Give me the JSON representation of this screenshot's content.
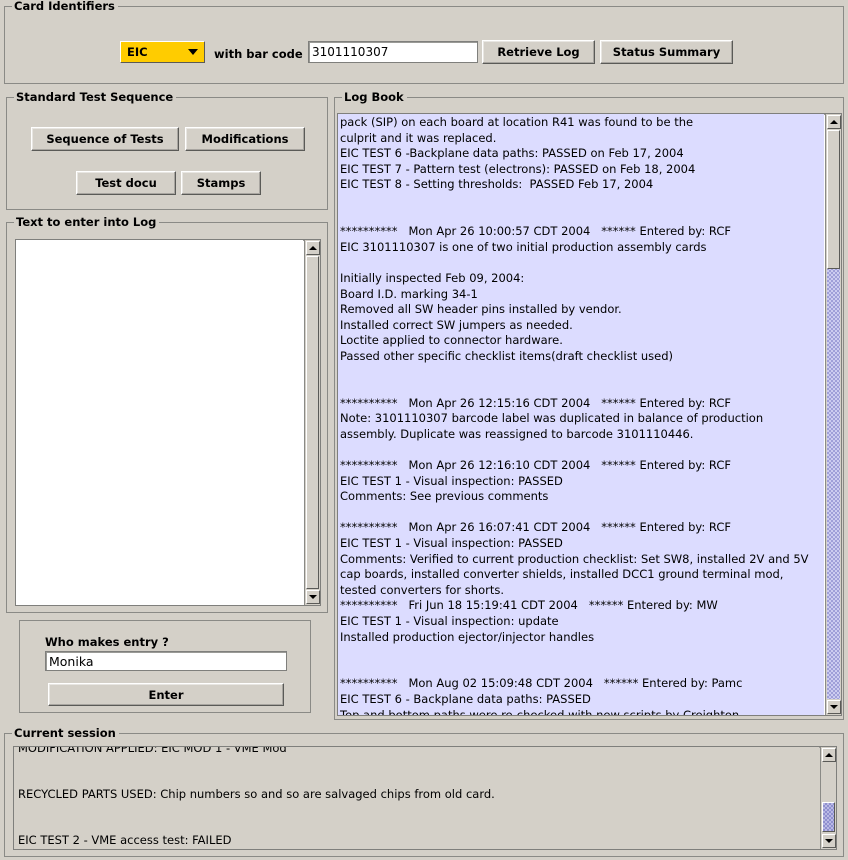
{
  "card_identifiers": {
    "title": "Card Identifiers",
    "card_type_selected": "EIC",
    "card_type_options": [
      "EIC"
    ],
    "with_barcode_label": "with bar code",
    "barcode_value": "3101110307",
    "retrieve_log_label": "Retrieve Log",
    "status_summary_label": "Status Summary",
    "combo_color": "#ffcc00"
  },
  "standard_test_sequence": {
    "title": "Standard Test Sequence",
    "buttons": [
      {
        "label": "Sequence of Tests"
      },
      {
        "label": "Modifications"
      },
      {
        "label": "Test docu"
      },
      {
        "label": "Stamps"
      }
    ]
  },
  "text_to_enter": {
    "title": "Text to enter into Log",
    "value": "",
    "placeholder": ""
  },
  "entry_panel": {
    "who_label": "Who makes entry ?",
    "who_value": "Monika",
    "enter_label": "Enter"
  },
  "log_book": {
    "title": "Log Book",
    "background_color": "#dcdcff",
    "text": "pack (SIP) on each board at location R41 was found to be the\nculprit and it was replaced.\nEIC TEST 6 -Backplane data paths: PASSED on Feb 17, 2004\nEIC TEST 7 - Pattern test (electrons): PASSED on Feb 18, 2004\nEIC TEST 8 - Setting thresholds:  PASSED Feb 17, 2004\n\n\n**********   Mon Apr 26 10:00:57 CDT 2004   ****** Entered by: RCF\nEIC 3101110307 is one of two initial production assembly cards\n\nInitially inspected Feb 09, 2004:\nBoard I.D. marking 34-1\nRemoved all SW header pins installed by vendor.\nInstalled correct SW jumpers as needed.\nLoctite applied to connector hardware.\nPassed other specific checklist items(draft checklist used)\n\n\n**********   Mon Apr 26 12:15:16 CDT 2004   ****** Entered by: RCF\nNote: 3101110307 barcode label was duplicated in balance of production\nassembly. Duplicate was reassigned to barcode 3101110446.\n\n**********   Mon Apr 26 12:16:10 CDT 2004   ****** Entered by: RCF\nEIC TEST 1 - Visual inspection: PASSED\nComments: See previous comments\n\n**********   Mon Apr 26 16:07:41 CDT 2004   ****** Entered by: RCF\nEIC TEST 1 - Visual inspection: PASSED\nComments: Verified to current production checklist: Set SW8, installed 2V and 5V\ncap boards, installed converter shields, installed DCC1 ground terminal mod,\ntested converters for shorts.\n**********   Fri Jun 18 15:19:41 CDT 2004   ****** Entered by: MW\nEIC TEST 1 - Visual inspection: update\nInstalled production ejector/injector handles\n\n\n**********   Mon Aug 02 15:09:48 CDT 2004   ****** Entered by: Pamc\nEIC TEST 6 - Backplane data paths: PASSED\nTop and bottom paths were re-checked with new scripts by Creighton"
  },
  "current_session": {
    "title": "Current session",
    "text": "MODIFICATION APPLIED: EIC MOD 1 - VME Mod\n\nRECYCLED PARTS USED: Chip numbers so and so are salvaged chips from old card.\n\nEIC TEST 2 - VME access test: FAILED\nTest failed in this and that way. Reasons are most likely those and those."
  },
  "icons": {
    "combo_arrow": "chevron-down-icon",
    "scroll_up": "scroll-up-arrow-icon",
    "scroll_down": "scroll-down-arrow-icon"
  }
}
